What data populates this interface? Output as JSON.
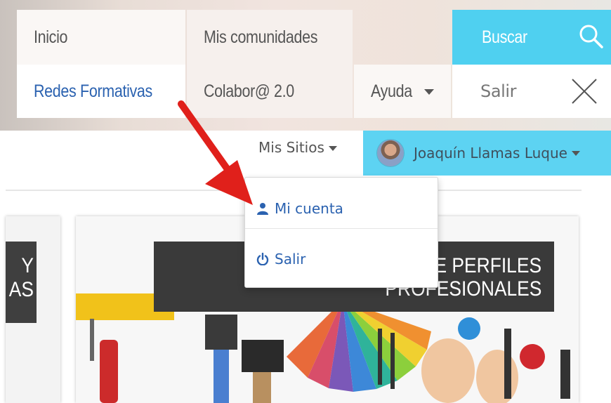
{
  "menu": {
    "row1": [
      {
        "label": "Inicio"
      },
      {
        "label": "Mis comunidades"
      }
    ],
    "search_label": "Buscar",
    "row2": [
      {
        "label": "Redes Formativas"
      },
      {
        "label": "Colabor@ 2.0"
      },
      {
        "label": "Ayuda"
      }
    ],
    "logout_label": "Salir"
  },
  "user_bar": {
    "sites_label": "Mis Sitios",
    "user_name": "Joaquín Llamas Luque"
  },
  "dropdown": {
    "items": [
      {
        "label": "Mi cuenta",
        "icon": "user-icon"
      },
      {
        "label": "Salir",
        "icon": "power-icon"
      }
    ]
  },
  "content": {
    "left_banner_lines": [
      "Y",
      "AS"
    ],
    "right_banner_lines": [
      "DE PERFILES",
      "PROFESIONALES"
    ]
  },
  "colors": {
    "accent_cyan": "#4fd0f0",
    "link_blue": "#2b62b0",
    "annotation_red": "#e0201b"
  }
}
